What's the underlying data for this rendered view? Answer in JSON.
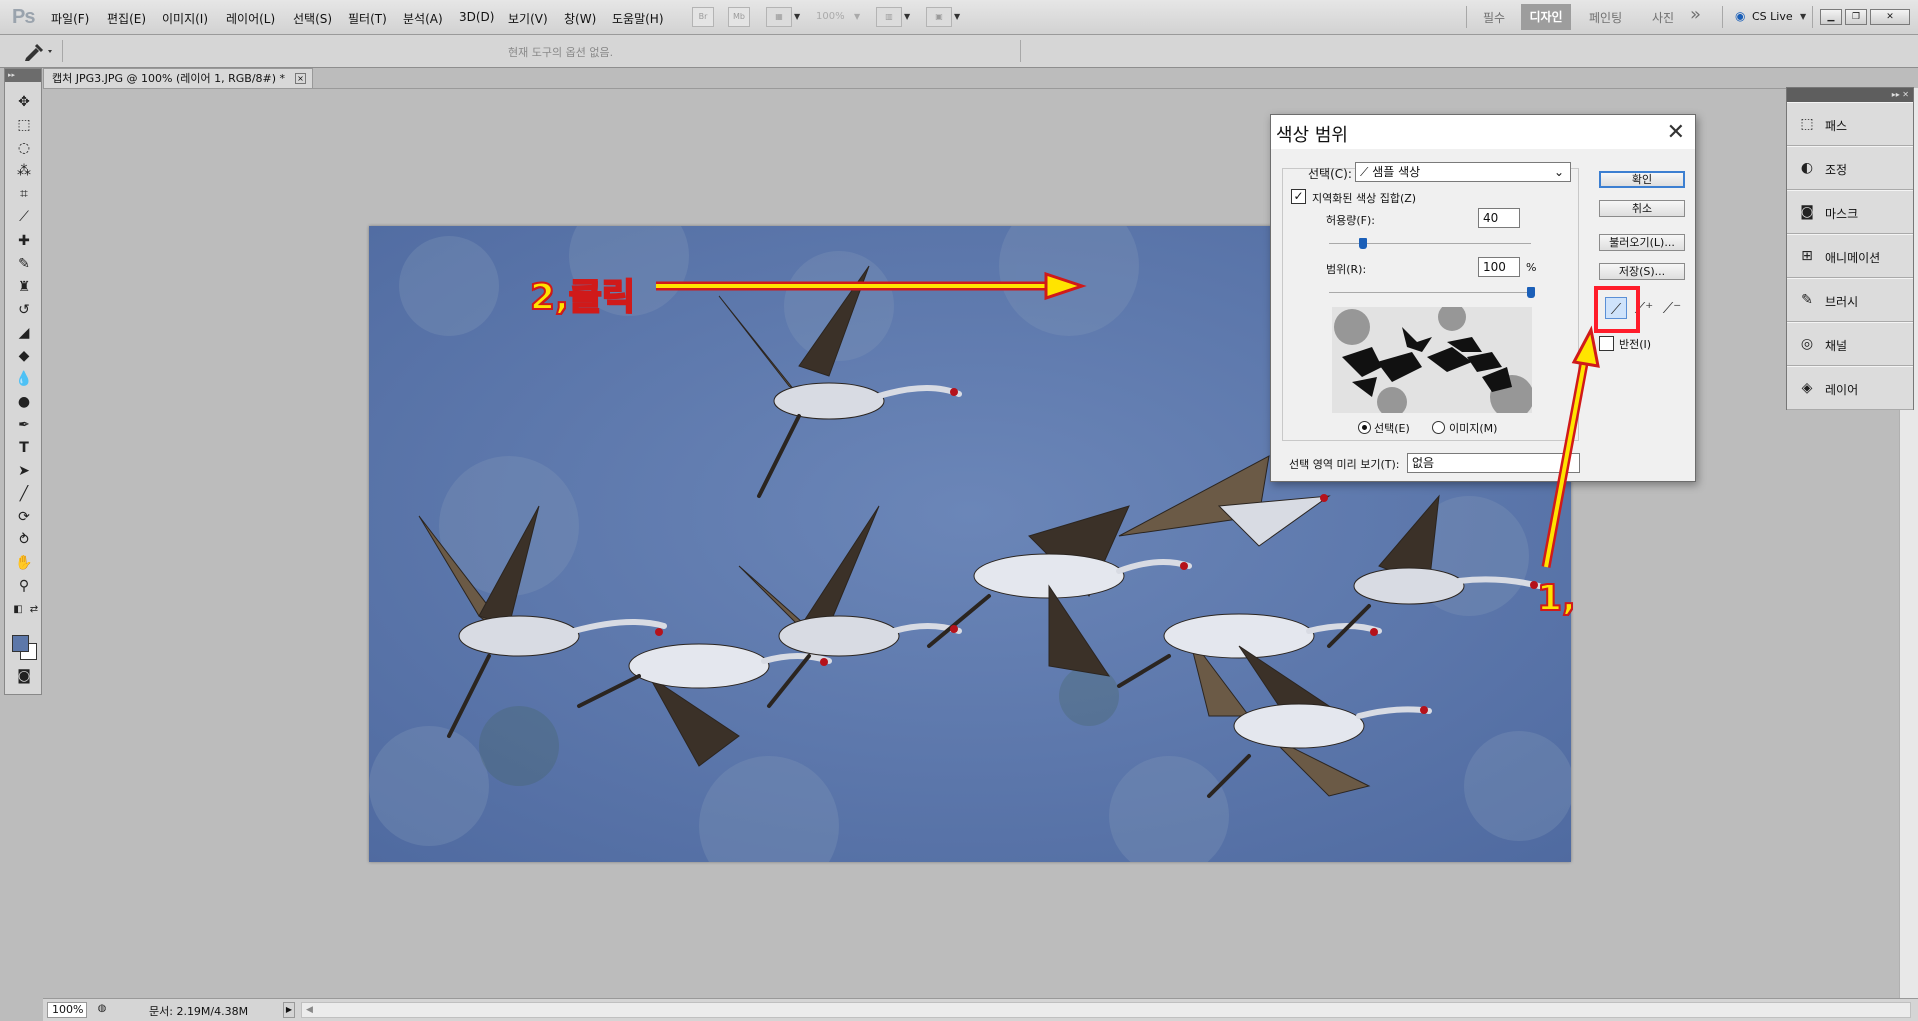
{
  "app": {
    "logo": "Ps",
    "menu": [
      "파일(F)",
      "편집(E)",
      "이미지(I)",
      "레이어(L)",
      "선택(S)",
      "필터(T)",
      "분석(A)",
      "3D(D)",
      "보기(V)",
      "창(W)",
      "도움말(H)"
    ],
    "toolbar": {
      "br": "Br",
      "mb": "Mb",
      "zoom": "100%"
    },
    "workspaces": {
      "essentials": "필수",
      "design": "디자인",
      "painting": "페인팅",
      "photography": "사진",
      "more": "»"
    },
    "cslive": "CS Live"
  },
  "options_bar": {
    "message": "현재 도구의 옵션 없음."
  },
  "document": {
    "tab_title": "캡처 JPG3.JPG @ 100% (레이어 1, RGB/8#) *",
    "close_glyph": "×",
    "zoom": "100%",
    "doc_size": "문서: 2.19M/4.38M"
  },
  "panels": [
    {
      "label": "패스",
      "icon": "paths-icon"
    },
    {
      "label": "조정",
      "icon": "adjustments-icon"
    },
    {
      "label": "마스크",
      "icon": "masks-icon"
    },
    {
      "label": "애니메이션",
      "icon": "animation-icon"
    },
    {
      "label": "브러시",
      "icon": "brush-icon"
    },
    {
      "label": "채널",
      "icon": "channels-icon"
    },
    {
      "label": "레이어",
      "icon": "layers-icon"
    }
  ],
  "dialog": {
    "title": "색상 범위",
    "close": "✕",
    "select_label": "선택(C):",
    "select_value": "샘플 색상",
    "localized_label": "지역화된 색상 집합(Z)",
    "localized_checked": true,
    "fuzziness_label": "허용량(F):",
    "fuzziness_value": "40",
    "fuzziness_fraction": 0.17,
    "range_label": "범위(R):",
    "range_value": "100",
    "range_unit": "%",
    "range_fraction": 1.0,
    "radio_selection": "선택(E)",
    "radio_image": "이미지(M)",
    "preview_label": "선택 영역 미리 보기(T):",
    "preview_value": "없음",
    "buttons": {
      "ok": "확인",
      "cancel": "취소",
      "load": "불러오기(L)...",
      "save": "저장(S)..."
    },
    "invert_label": "반전(I)"
  },
  "annotations": {
    "step1": "1,",
    "step2": "2,클릭"
  },
  "colors": {
    "foreground": "#5c77a9",
    "background": "#ffffff",
    "highlight": "#ff1c2a",
    "annotation": "#ffe400"
  }
}
